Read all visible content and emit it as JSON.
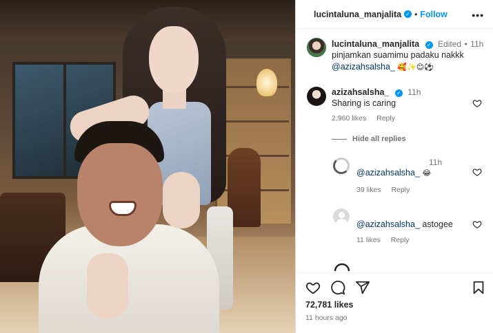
{
  "header": {
    "username": "lucintaluna_manjalita",
    "separator": "•",
    "follow_label": "Follow",
    "more_label": "•••"
  },
  "caption": {
    "username": "lucintaluna_manjalita",
    "edited": "Edited",
    "separator": "•",
    "time": "11h",
    "text": "pinjamkan suamimu padaku nakkk",
    "mention": "@azizahsalsha_",
    "emojis": "🥰✨😊⚽"
  },
  "comments": [
    {
      "username": "azizahsalsha_",
      "time": "11h",
      "text": "Sharing is caring",
      "likes": "2,960 likes",
      "reply_label": "Reply"
    }
  ],
  "hide_replies_label": "Hide all replies",
  "replies": [
    {
      "time": "11h",
      "mention": "@azizahsalsha_",
      "emoji": "😂",
      "text": "",
      "likes": "39 likes",
      "reply_label": "Reply"
    },
    {
      "time": "",
      "mention": "@azizahsalsha_",
      "emoji": "",
      "text": "astogee",
      "likes": "11 likes",
      "reply_label": "Reply"
    }
  ],
  "post": {
    "likes": "72,781 likes",
    "time_ago": "11 hours ago"
  },
  "colors": {
    "accent": "#0095f6",
    "mention": "#00376b",
    "secondary_text": "#737373"
  },
  "icons": [
    "heart-icon",
    "comment-icon",
    "share-icon",
    "bookmark-icon",
    "verified-icon",
    "more-icon"
  ]
}
